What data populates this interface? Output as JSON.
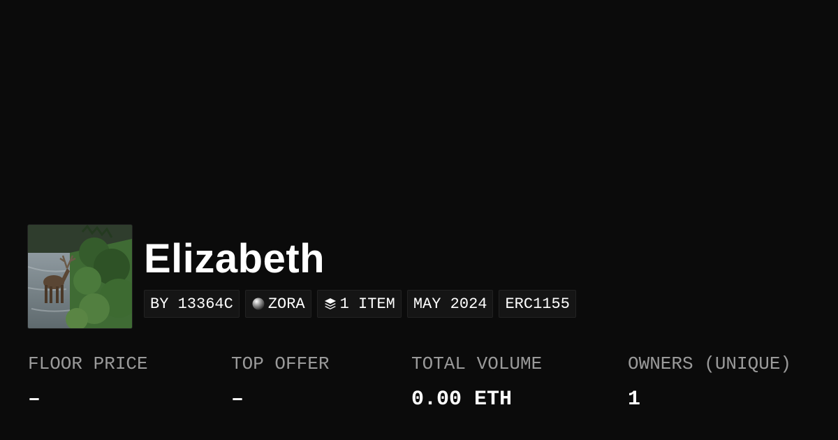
{
  "collection": {
    "name": "Elizabeth",
    "thumbnail_icon": "elk-in-river-photo"
  },
  "badges": {
    "creator": "BY 13364C",
    "network": "ZORA",
    "network_icon": "zora-orb-icon",
    "items": "1 ITEM",
    "items_icon": "layers-icon",
    "date": "MAY 2024",
    "standard": "ERC1155"
  },
  "stats": [
    {
      "label": "FLOOR PRICE",
      "value": "–"
    },
    {
      "label": "TOP OFFER",
      "value": "–"
    },
    {
      "label": "TOTAL VOLUME",
      "value": "0.00 ETH"
    },
    {
      "label": "OWNERS (UNIQUE)",
      "value": "1"
    }
  ],
  "colors": {
    "background": "#0b0b0b",
    "badge_background": "#151515",
    "label": "#9a9a9a",
    "text": "#ffffff"
  }
}
